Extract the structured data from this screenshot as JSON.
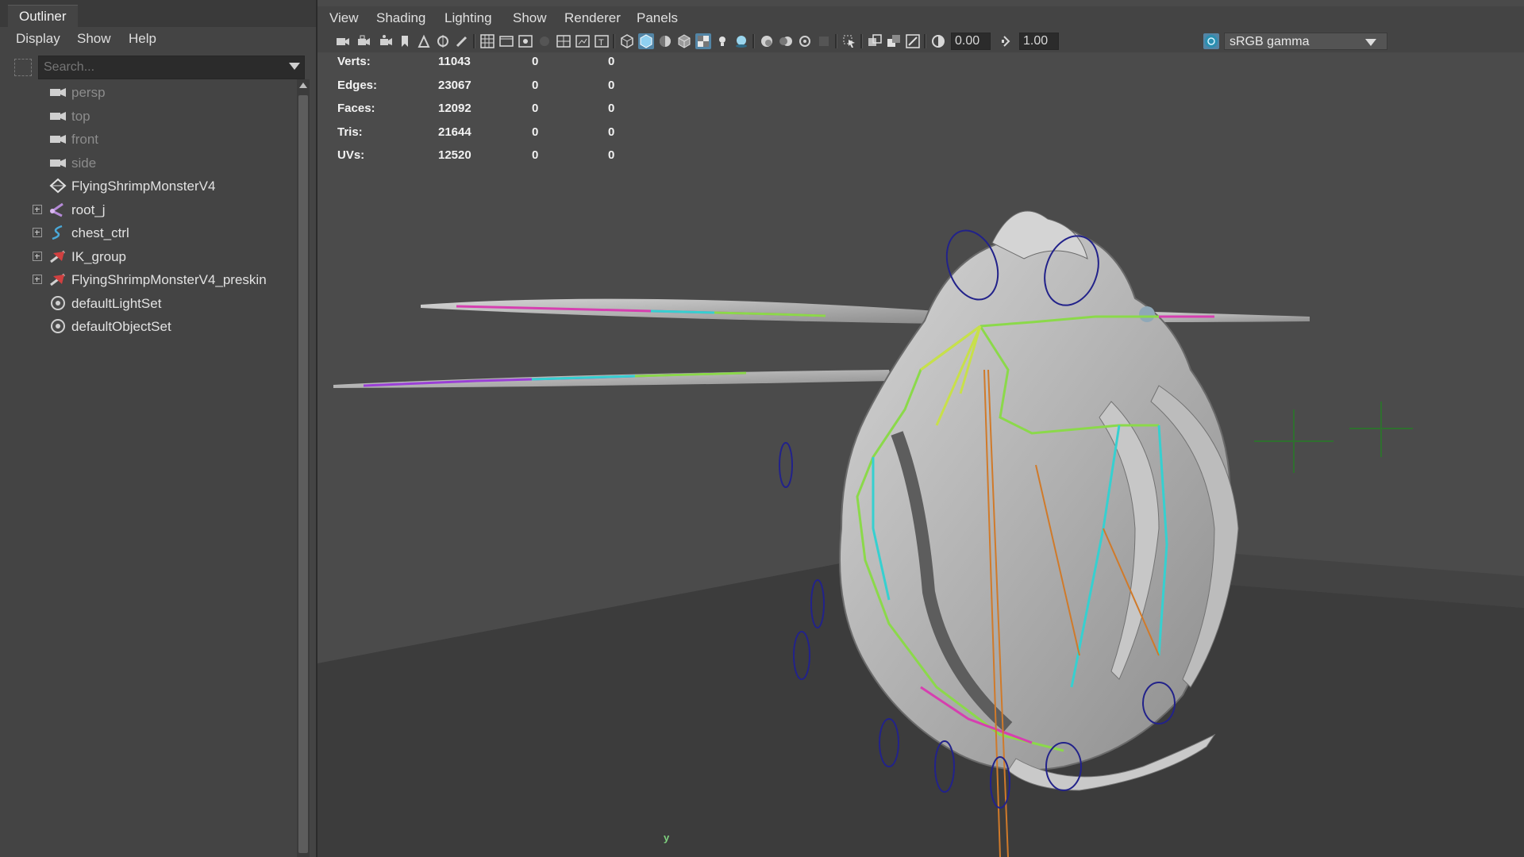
{
  "outliner": {
    "tab_label": "Outliner",
    "menu": [
      "Display",
      "Show",
      "Help"
    ],
    "search_placeholder": "Search...",
    "items": [
      {
        "label": "persp",
        "icon": "camera-icon",
        "dim": true,
        "expandable": false
      },
      {
        "label": "top",
        "icon": "camera-icon",
        "dim": true,
        "expandable": false
      },
      {
        "label": "front",
        "icon": "camera-icon",
        "dim": true,
        "expandable": false
      },
      {
        "label": "side",
        "icon": "camera-icon",
        "dim": true,
        "expandable": false
      },
      {
        "label": "FlyingShrimpMonsterV4",
        "icon": "mesh-icon",
        "dim": false,
        "expandable": false
      },
      {
        "label": "root_j",
        "icon": "joint-icon",
        "dim": false,
        "expandable": true
      },
      {
        "label": "chest_ctrl",
        "icon": "curve-icon",
        "dim": false,
        "expandable": true
      },
      {
        "label": "IK_group",
        "icon": "ik-group-icon",
        "dim": false,
        "expandable": true
      },
      {
        "label": "FlyingShrimpMonsterV4_preskin",
        "icon": "ik-group-icon",
        "dim": false,
        "expandable": true
      },
      {
        "label": "defaultLightSet",
        "icon": "set-icon",
        "dim": false,
        "expandable": false
      },
      {
        "label": "defaultObjectSet",
        "icon": "set-icon",
        "dim": false,
        "expandable": false
      }
    ]
  },
  "viewport": {
    "menu": [
      "View",
      "Shading",
      "Lighting",
      "Show",
      "Renderer",
      "Panels"
    ],
    "exposure_value": "0.00",
    "gamma_value": "1.00",
    "colorspace": "sRGB gamma",
    "axis_label": "y",
    "hud": [
      {
        "label": "Verts:",
        "v1": "11043",
        "v2": "0",
        "v3": "0"
      },
      {
        "label": "Edges:",
        "v1": "23067",
        "v2": "0",
        "v3": "0"
      },
      {
        "label": "Faces:",
        "v1": "12092",
        "v2": "0",
        "v3": "0"
      },
      {
        "label": "Tris:",
        "v1": "21644",
        "v2": "0",
        "v3": "0"
      },
      {
        "label": "UVs:",
        "v1": "12520",
        "v2": "0",
        "v3": "0"
      }
    ]
  },
  "colors": {
    "active_button": "#5285a6",
    "joint_green": "#8bd94a",
    "joint_cyan": "#36d0d0",
    "joint_magenta": "#d63fb0",
    "control_blue": "#22228a",
    "ik_orange": "#d07a2a"
  }
}
